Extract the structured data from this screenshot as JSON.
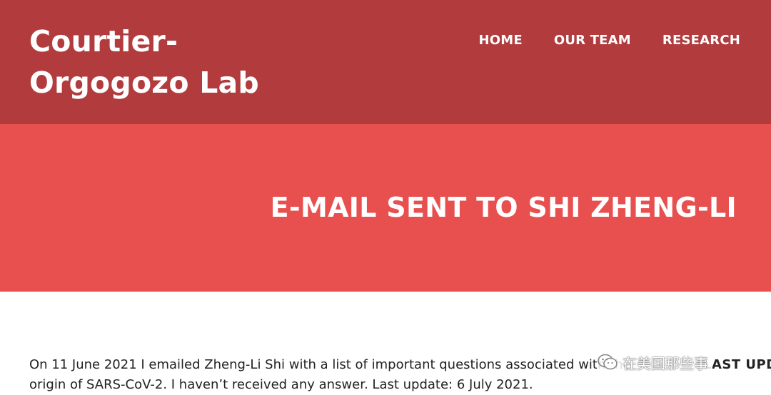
{
  "header": {
    "site_title_line1": "Courtier-",
    "site_title_line2": "Orgogozo Lab",
    "nav": [
      {
        "label": "HOME"
      },
      {
        "label": "OUR TEAM"
      },
      {
        "label": "RESEARCH"
      }
    ]
  },
  "banner": {
    "title": "E-MAIL SENT TO SHI ZHENG-LI"
  },
  "content": {
    "line1": "On 11 June 2021 I emailed Zheng-Li Shi with a list of important questions associated with the",
    "line2": "origin of SARS-CoV-2. I haven’t received any answer. Last update: 6 July 2021.",
    "side_label": "LAST UPDA"
  },
  "watermark": {
    "text": "在美国那些事",
    "icon": "wechat-icon"
  },
  "colors": {
    "header_bg": "#b13b3d",
    "banner_bg": "#e85050",
    "text": "#222222"
  }
}
